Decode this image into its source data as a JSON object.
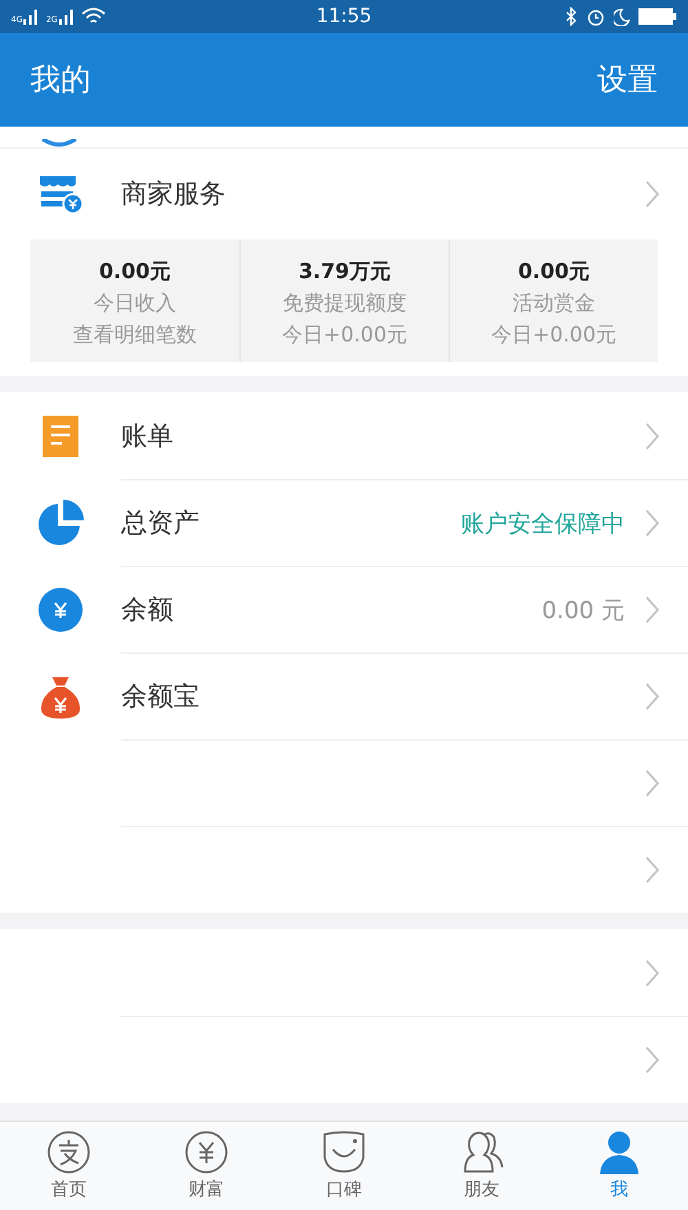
{
  "status_bar": {
    "network_1": "4G",
    "network_2": "2G",
    "time": "11:55"
  },
  "header": {
    "title": "我的",
    "action": "设置"
  },
  "merchant": {
    "label": "商家服务",
    "stats": [
      {
        "value": "0.00元",
        "label": "今日收入",
        "note": "查看明细笔数"
      },
      {
        "value": "3.79万元",
        "label": "免费提现额度",
        "note": "今日+0.00元"
      },
      {
        "value": "0.00元",
        "label": "活动赏金",
        "note": "今日+0.00元"
      }
    ]
  },
  "sections": [
    {
      "rows": [
        {
          "kind": "plain",
          "label": "账单"
        },
        {
          "kind": "status",
          "label": "总资产",
          "detail": "账户安全保障中"
        },
        {
          "kind": "amount",
          "label": "余额",
          "detail": "0.00 元"
        },
        {
          "kind": "plain",
          "label": "余额宝"
        },
        {
          "kind": "blank"
        },
        {
          "kind": "blank"
        }
      ]
    },
    {
      "rows": [
        {
          "kind": "blank"
        },
        {
          "kind": "blank"
        }
      ]
    }
  ],
  "tabs": [
    {
      "label": "首页",
      "selected": false
    },
    {
      "label": "财富",
      "selected": false
    },
    {
      "label": "口碑",
      "selected": false
    },
    {
      "label": "朋友",
      "selected": false
    },
    {
      "label": "我",
      "selected": true
    }
  ]
}
